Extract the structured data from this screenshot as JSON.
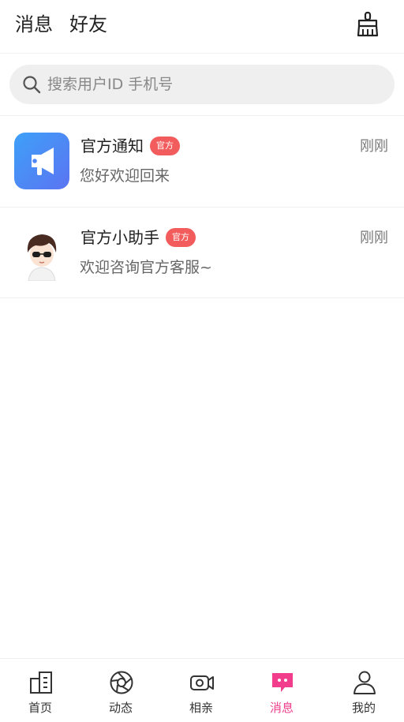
{
  "header": {
    "tabs": [
      {
        "label": "消息",
        "active": true
      },
      {
        "label": "好友",
        "active": false
      }
    ],
    "clean_icon": "broom-icon"
  },
  "search": {
    "placeholder": "搜索用户ID 手机号",
    "icon": "search-icon"
  },
  "conversations": [
    {
      "name": "官方通知",
      "badge": "官方",
      "preview": "您好欢迎回来",
      "time": "刚刚",
      "avatar": "megaphone-icon",
      "avatar_color": "#4f88f5"
    },
    {
      "name": "官方小助手",
      "badge": "官方",
      "preview": "欢迎咨询官方客服~",
      "time": "刚刚",
      "avatar": "assistant-avatar"
    }
  ],
  "bottom_nav": [
    {
      "label": "首页",
      "icon": "home-icon",
      "active": false
    },
    {
      "label": "动态",
      "icon": "aperture-icon",
      "active": false
    },
    {
      "label": "相亲",
      "icon": "video-camera-icon",
      "active": false
    },
    {
      "label": "消息",
      "icon": "message-icon",
      "active": true
    },
    {
      "label": "我的",
      "icon": "profile-icon",
      "active": false
    }
  ],
  "colors": {
    "accent": "#f13d8c",
    "badge": "#f25c5c",
    "search_bg": "#efefef"
  }
}
